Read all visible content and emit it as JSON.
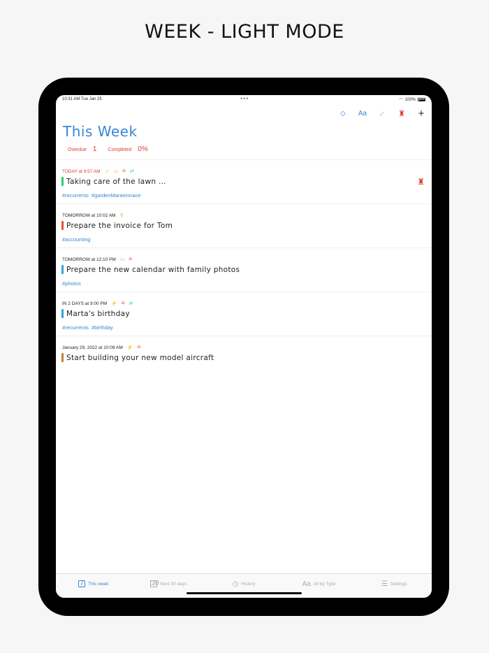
{
  "headline": "WEEK - LIGHT MODE",
  "status_bar": {
    "time": "10:31 AM   Tue Jan 25",
    "dots": "•••",
    "battery": "100%"
  },
  "toolbar": {
    "tag_icon": "◇",
    "font_label": "Aa",
    "check_icon": "✓",
    "person_icon": "♜",
    "plus_label": "+"
  },
  "page": {
    "title": "This Week",
    "overdue_label": "Overdue",
    "overdue_value": "1",
    "completed_label": "Completed",
    "completed_value": "0%"
  },
  "tasks": [
    {
      "meta": "TODAY at 9:57 AM",
      "icons": [
        "☺",
        "▭",
        "🔔",
        "⇄"
      ],
      "title": "Taking care of the lawn ...",
      "tags": [
        "#recurrents",
        "#gardenManteinnace"
      ],
      "bar_color": "#2ecc71",
      "flag": true
    },
    {
      "meta": "TOMORROW at 10:02 AM",
      "icons": [
        "⚲"
      ],
      "title": "Prepare the invoice for Tom",
      "tags": [
        "#accounting"
      ],
      "bar_color": "#e0533a",
      "flag": false
    },
    {
      "meta": "TOMORROW at 12:10 PM",
      "icons": [
        "▭",
        "🔔"
      ],
      "title": "Prepare the new calendar with family photos",
      "tags": [
        "#photos"
      ],
      "bar_color": "#3aa0d8",
      "flag": false
    },
    {
      "meta": "IN 2 DAYS at 9:00 PM",
      "icons": [
        "⚡",
        "🔔",
        "⇄"
      ],
      "title": "Marta's birthday",
      "tags": [
        "#recurrents",
        "#birthday"
      ],
      "bar_color": "#3aa0d8",
      "flag": false
    },
    {
      "meta": "January 29, 2022 at 10:09 AM",
      "icons": [
        "⚡",
        "🔔"
      ],
      "title": "Start building your new model aircraft",
      "tags": [],
      "bar_color": "#c08040",
      "flag": false
    }
  ],
  "tabbar": [
    {
      "label": "This week",
      "icon": "7"
    },
    {
      "label": "Next 30 days",
      "icon": "30"
    },
    {
      "label": "History",
      "icon": "◷"
    },
    {
      "label": "All by Type",
      "icon": "Aa"
    },
    {
      "label": "Settings",
      "icon": "☰"
    }
  ],
  "colors": {
    "accent": "#3a86d4",
    "alert": "#e03b2d"
  }
}
